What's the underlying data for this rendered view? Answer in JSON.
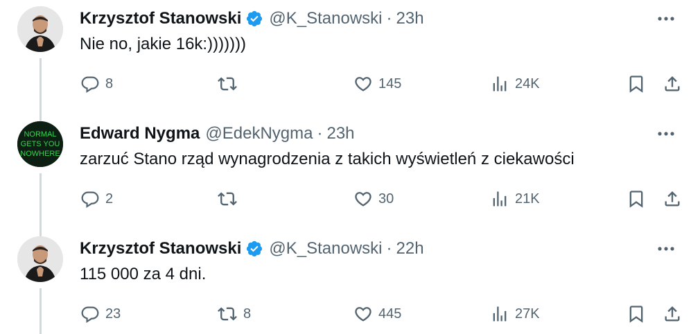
{
  "tweets": [
    {
      "name": "Krzysztof Stanowski",
      "verified": true,
      "handle": "@K_Stanowski",
      "separator": "·",
      "time": "23h",
      "text": "Nie no, jakie 16k:)))))))",
      "replies": "8",
      "retweets": "",
      "likes": "145",
      "views": "24K",
      "avatar": "person-avatar"
    },
    {
      "name": "Edward Nygma",
      "verified": false,
      "handle": "@EdekNygma",
      "separator": "·",
      "time": "23h",
      "text": "zarzuć Stano rząd wynagrodzenia z takich wyświetleń z ciekawości",
      "replies": "2",
      "retweets": "",
      "likes": "30",
      "views": "21K",
      "avatar": "neon-sign-avatar",
      "avatar_text": [
        "NORMAL",
        "GETS YOU",
        "NOWHERE"
      ]
    },
    {
      "name": "Krzysztof Stanowski",
      "verified": true,
      "handle": "@K_Stanowski",
      "separator": "·",
      "time": "22h",
      "text": "115 000 za 4 dni.",
      "replies": "23",
      "retweets": "8",
      "likes": "445",
      "views": "27K",
      "avatar": "person-avatar"
    }
  ],
  "colors": {
    "text": "#0f1419",
    "secondary": "#536471",
    "verified": "#1d9bf0",
    "thread_line": "#cfd9de",
    "neon": "#39d353"
  }
}
